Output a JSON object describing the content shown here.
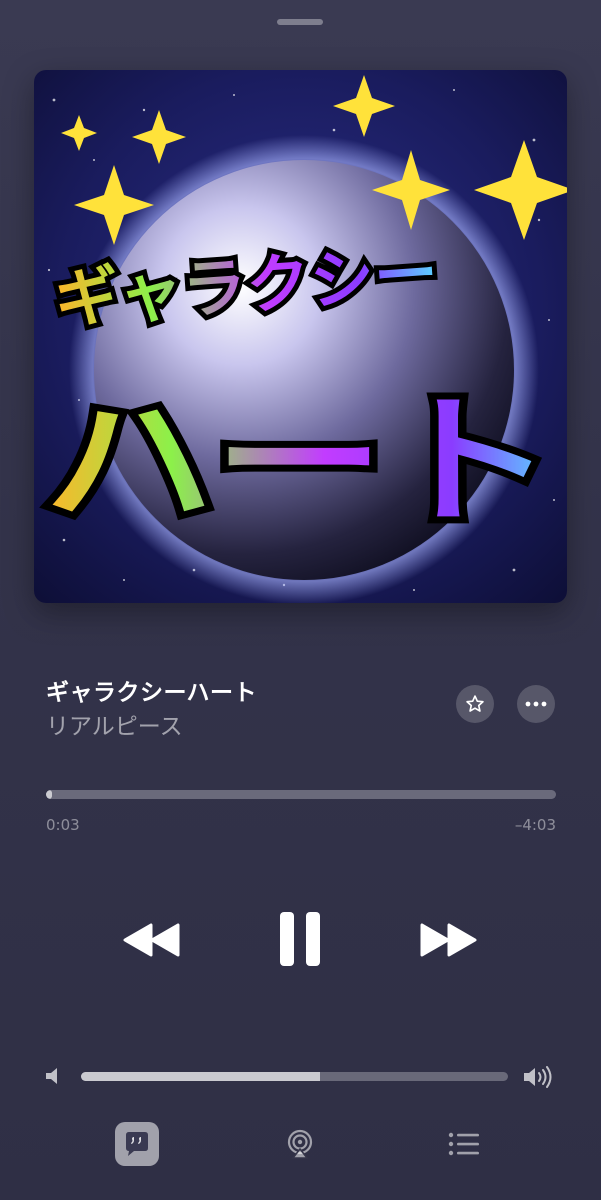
{
  "album_art": {
    "title_line1": "ギャラクシー",
    "title_line2": "ハート"
  },
  "track": {
    "title": "ギャラクシーハート",
    "artist": "リアルピース"
  },
  "actions": {
    "favorite_icon": "star-icon",
    "more_icon": "ellipsis-icon"
  },
  "playback": {
    "elapsed": "0:03",
    "remaining": "–4:03",
    "progress_fraction": 0.012,
    "state": "playing"
  },
  "volume": {
    "level_fraction": 0.56
  },
  "bottom_bar": {
    "items": [
      "lyrics-icon",
      "airplay-icon",
      "queue-icon"
    ]
  }
}
